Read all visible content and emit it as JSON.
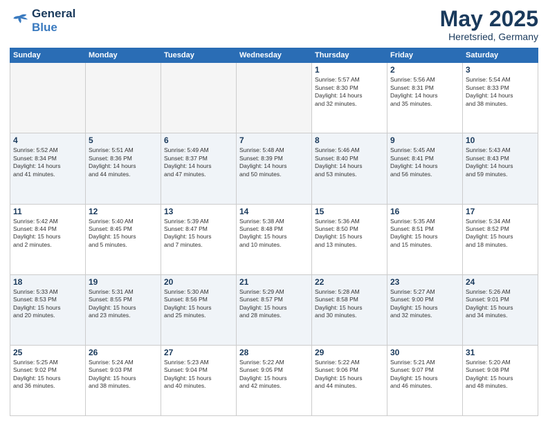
{
  "header": {
    "logo_line1": "General",
    "logo_line2": "Blue",
    "month_title": "May 2025",
    "location": "Heretsried, Germany"
  },
  "weekdays": [
    "Sunday",
    "Monday",
    "Tuesday",
    "Wednesday",
    "Thursday",
    "Friday",
    "Saturday"
  ],
  "weeks": [
    [
      {
        "day": "",
        "info": ""
      },
      {
        "day": "",
        "info": ""
      },
      {
        "day": "",
        "info": ""
      },
      {
        "day": "",
        "info": ""
      },
      {
        "day": "1",
        "info": "Sunrise: 5:57 AM\nSunset: 8:30 PM\nDaylight: 14 hours\nand 32 minutes."
      },
      {
        "day": "2",
        "info": "Sunrise: 5:56 AM\nSunset: 8:31 PM\nDaylight: 14 hours\nand 35 minutes."
      },
      {
        "day": "3",
        "info": "Sunrise: 5:54 AM\nSunset: 8:33 PM\nDaylight: 14 hours\nand 38 minutes."
      }
    ],
    [
      {
        "day": "4",
        "info": "Sunrise: 5:52 AM\nSunset: 8:34 PM\nDaylight: 14 hours\nand 41 minutes."
      },
      {
        "day": "5",
        "info": "Sunrise: 5:51 AM\nSunset: 8:36 PM\nDaylight: 14 hours\nand 44 minutes."
      },
      {
        "day": "6",
        "info": "Sunrise: 5:49 AM\nSunset: 8:37 PM\nDaylight: 14 hours\nand 47 minutes."
      },
      {
        "day": "7",
        "info": "Sunrise: 5:48 AM\nSunset: 8:39 PM\nDaylight: 14 hours\nand 50 minutes."
      },
      {
        "day": "8",
        "info": "Sunrise: 5:46 AM\nSunset: 8:40 PM\nDaylight: 14 hours\nand 53 minutes."
      },
      {
        "day": "9",
        "info": "Sunrise: 5:45 AM\nSunset: 8:41 PM\nDaylight: 14 hours\nand 56 minutes."
      },
      {
        "day": "10",
        "info": "Sunrise: 5:43 AM\nSunset: 8:43 PM\nDaylight: 14 hours\nand 59 minutes."
      }
    ],
    [
      {
        "day": "11",
        "info": "Sunrise: 5:42 AM\nSunset: 8:44 PM\nDaylight: 15 hours\nand 2 minutes."
      },
      {
        "day": "12",
        "info": "Sunrise: 5:40 AM\nSunset: 8:45 PM\nDaylight: 15 hours\nand 5 minutes."
      },
      {
        "day": "13",
        "info": "Sunrise: 5:39 AM\nSunset: 8:47 PM\nDaylight: 15 hours\nand 7 minutes."
      },
      {
        "day": "14",
        "info": "Sunrise: 5:38 AM\nSunset: 8:48 PM\nDaylight: 15 hours\nand 10 minutes."
      },
      {
        "day": "15",
        "info": "Sunrise: 5:36 AM\nSunset: 8:50 PM\nDaylight: 15 hours\nand 13 minutes."
      },
      {
        "day": "16",
        "info": "Sunrise: 5:35 AM\nSunset: 8:51 PM\nDaylight: 15 hours\nand 15 minutes."
      },
      {
        "day": "17",
        "info": "Sunrise: 5:34 AM\nSunset: 8:52 PM\nDaylight: 15 hours\nand 18 minutes."
      }
    ],
    [
      {
        "day": "18",
        "info": "Sunrise: 5:33 AM\nSunset: 8:53 PM\nDaylight: 15 hours\nand 20 minutes."
      },
      {
        "day": "19",
        "info": "Sunrise: 5:31 AM\nSunset: 8:55 PM\nDaylight: 15 hours\nand 23 minutes."
      },
      {
        "day": "20",
        "info": "Sunrise: 5:30 AM\nSunset: 8:56 PM\nDaylight: 15 hours\nand 25 minutes."
      },
      {
        "day": "21",
        "info": "Sunrise: 5:29 AM\nSunset: 8:57 PM\nDaylight: 15 hours\nand 28 minutes."
      },
      {
        "day": "22",
        "info": "Sunrise: 5:28 AM\nSunset: 8:58 PM\nDaylight: 15 hours\nand 30 minutes."
      },
      {
        "day": "23",
        "info": "Sunrise: 5:27 AM\nSunset: 9:00 PM\nDaylight: 15 hours\nand 32 minutes."
      },
      {
        "day": "24",
        "info": "Sunrise: 5:26 AM\nSunset: 9:01 PM\nDaylight: 15 hours\nand 34 minutes."
      }
    ],
    [
      {
        "day": "25",
        "info": "Sunrise: 5:25 AM\nSunset: 9:02 PM\nDaylight: 15 hours\nand 36 minutes."
      },
      {
        "day": "26",
        "info": "Sunrise: 5:24 AM\nSunset: 9:03 PM\nDaylight: 15 hours\nand 38 minutes."
      },
      {
        "day": "27",
        "info": "Sunrise: 5:23 AM\nSunset: 9:04 PM\nDaylight: 15 hours\nand 40 minutes."
      },
      {
        "day": "28",
        "info": "Sunrise: 5:22 AM\nSunset: 9:05 PM\nDaylight: 15 hours\nand 42 minutes."
      },
      {
        "day": "29",
        "info": "Sunrise: 5:22 AM\nSunset: 9:06 PM\nDaylight: 15 hours\nand 44 minutes."
      },
      {
        "day": "30",
        "info": "Sunrise: 5:21 AM\nSunset: 9:07 PM\nDaylight: 15 hours\nand 46 minutes."
      },
      {
        "day": "31",
        "info": "Sunrise: 5:20 AM\nSunset: 9:08 PM\nDaylight: 15 hours\nand 48 minutes."
      }
    ]
  ]
}
